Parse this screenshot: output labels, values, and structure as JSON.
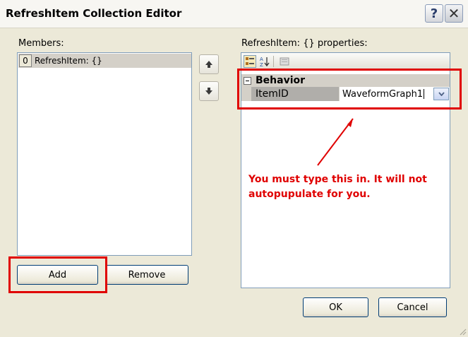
{
  "window": {
    "title": "RefreshItem Collection Editor",
    "help_button": "?",
    "close_button": "✕"
  },
  "members": {
    "label": "Members:",
    "items": [
      {
        "index": "0",
        "text": "RefreshItem: {}"
      }
    ],
    "move_up": "▲",
    "move_down": "▼"
  },
  "buttons": {
    "add": "Add",
    "remove": "Remove",
    "ok": "OK",
    "cancel": "Cancel"
  },
  "properties": {
    "label": "RefreshItem: {} properties:",
    "category": "Behavior",
    "rows": [
      {
        "name": "ItemID",
        "value": "WaveformGraph1"
      }
    ]
  },
  "annotation": {
    "text": "You must type this in. It will not autopupulate for you.",
    "color": "#e00000"
  }
}
